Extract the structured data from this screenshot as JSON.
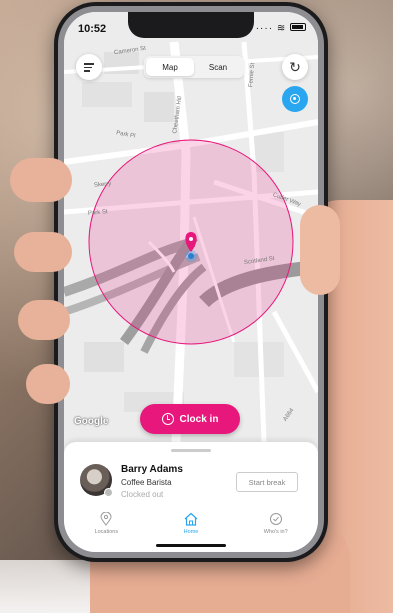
{
  "status_bar": {
    "time": "10:52",
    "signal": "····"
  },
  "map": {
    "mode_tabs": [
      {
        "label": "Map",
        "active": true
      },
      {
        "label": "Scan",
        "active": false
      }
    ],
    "street_labels": [
      "Cameron St",
      "Cheetham Hill",
      "Fernie St",
      "Park Pl",
      "Skerry",
      "Park St",
      "Cutler Way",
      "Scotland St",
      "A664"
    ],
    "attribution": "Google",
    "geofence_color": "#e8177b"
  },
  "clock_in_button": {
    "label": "Clock in"
  },
  "user": {
    "name": "Barry Adams",
    "role": "Coffee Barista",
    "status": "Clocked out"
  },
  "start_break_button": {
    "label": "Start break"
  },
  "tabbar": {
    "items": [
      {
        "label": "Locations",
        "icon": "location-pin-icon",
        "active": false
      },
      {
        "label": "Home",
        "icon": "home-icon",
        "active": true
      },
      {
        "label": "Who's in?",
        "icon": "whos-in-icon",
        "active": false
      }
    ]
  },
  "colors": {
    "accent_pink": "#e8177b",
    "accent_blue": "#2aa6f0"
  }
}
